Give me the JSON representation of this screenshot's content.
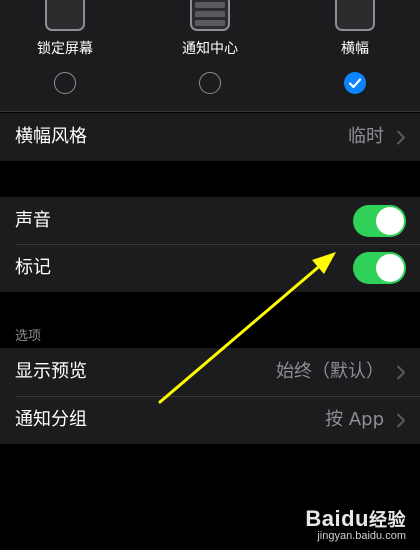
{
  "alert_styles": {
    "options": [
      {
        "label": "锁定屏幕",
        "checked": false,
        "icon": "lock-screen-phone-icon"
      },
      {
        "label": "通知中心",
        "checked": false,
        "icon": "notification-center-phone-icon"
      },
      {
        "label": "横幅",
        "checked": true,
        "icon": "banner-phone-icon"
      }
    ]
  },
  "banner_style": {
    "label": "横幅风格",
    "value": "临时"
  },
  "sounds": {
    "label": "声音",
    "enabled": true
  },
  "badges": {
    "label": "标记",
    "enabled": true
  },
  "options_section": {
    "header": "选项"
  },
  "show_previews": {
    "label": "显示预览",
    "value": "始终（默认）"
  },
  "notification_grouping": {
    "label": "通知分组",
    "value": "按 App"
  },
  "watermark": {
    "brand": "Bai",
    "brand_paw": "du",
    "brand_zh": "经验",
    "site": "jingyan.baidu.com"
  },
  "colors": {
    "background": "#000000",
    "cell": "#1c1c1e",
    "secondary_text": "#8e8e93",
    "accent_blue": "#0a84ff",
    "toggle_green": "#30d158",
    "annotation_arrow": "#ffff00"
  }
}
